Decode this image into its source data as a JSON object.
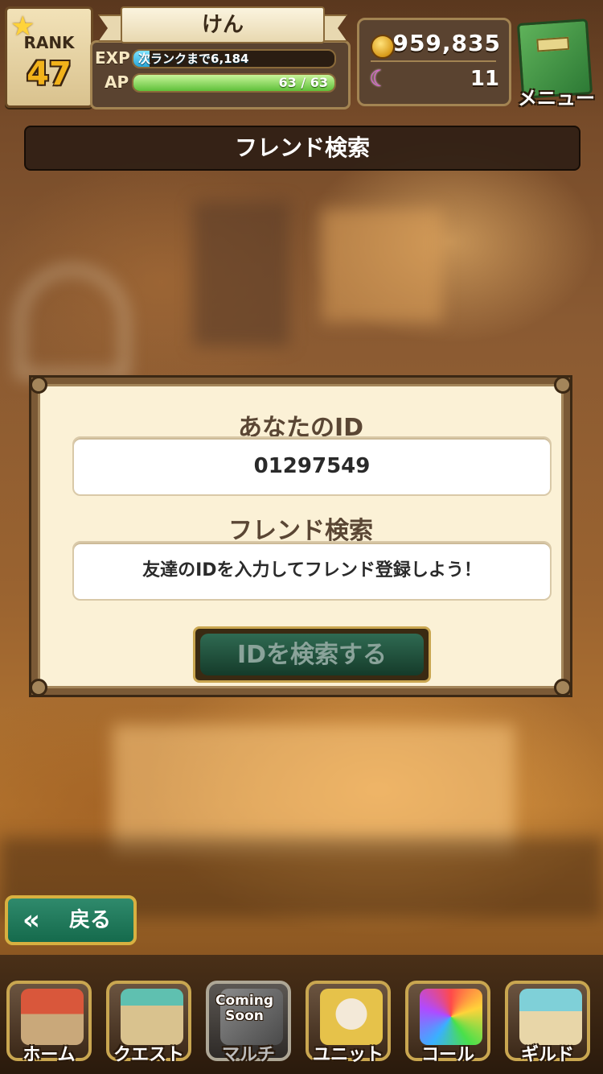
{
  "player": {
    "rank_label": "RANK",
    "rank": "47",
    "name": "けん",
    "exp_label": "EXP",
    "exp_text": "次ランクまで6,184",
    "exp_fraction": 0.08,
    "ap_label": "AP",
    "ap_text": "63 / 63",
    "ap_fraction": 1.0
  },
  "currency": {
    "coins": "959,835",
    "gems": "11"
  },
  "menu": {
    "label": "メニュー"
  },
  "page": {
    "title": "フレンド検索"
  },
  "dialog": {
    "id_label": "あなたのID",
    "id_value": "01297549",
    "search_label": "フレンド検索",
    "search_placeholder": "友達のIDを入力してフレンド登録しよう！",
    "search_button": "IDを検索する"
  },
  "back": {
    "arrow": "«",
    "label": "戻る"
  },
  "nav": {
    "items": [
      {
        "label": "ホーム",
        "icon": "home-icon"
      },
      {
        "label": "クエスト",
        "icon": "quest-gate-icon"
      },
      {
        "label": "マルチ",
        "icon": "multi-icon",
        "badge": "Coming Soon"
      },
      {
        "label": "ユニット",
        "icon": "unit-icon"
      },
      {
        "label": "コール",
        "icon": "call-icon"
      },
      {
        "label": "ギルド",
        "icon": "guild-icon"
      }
    ]
  },
  "colors": {
    "accent_gold": "#c9a650",
    "button_green": "#2f6a52",
    "exp_blue": "#2aa6d8",
    "ap_green": "#5fc03a"
  }
}
